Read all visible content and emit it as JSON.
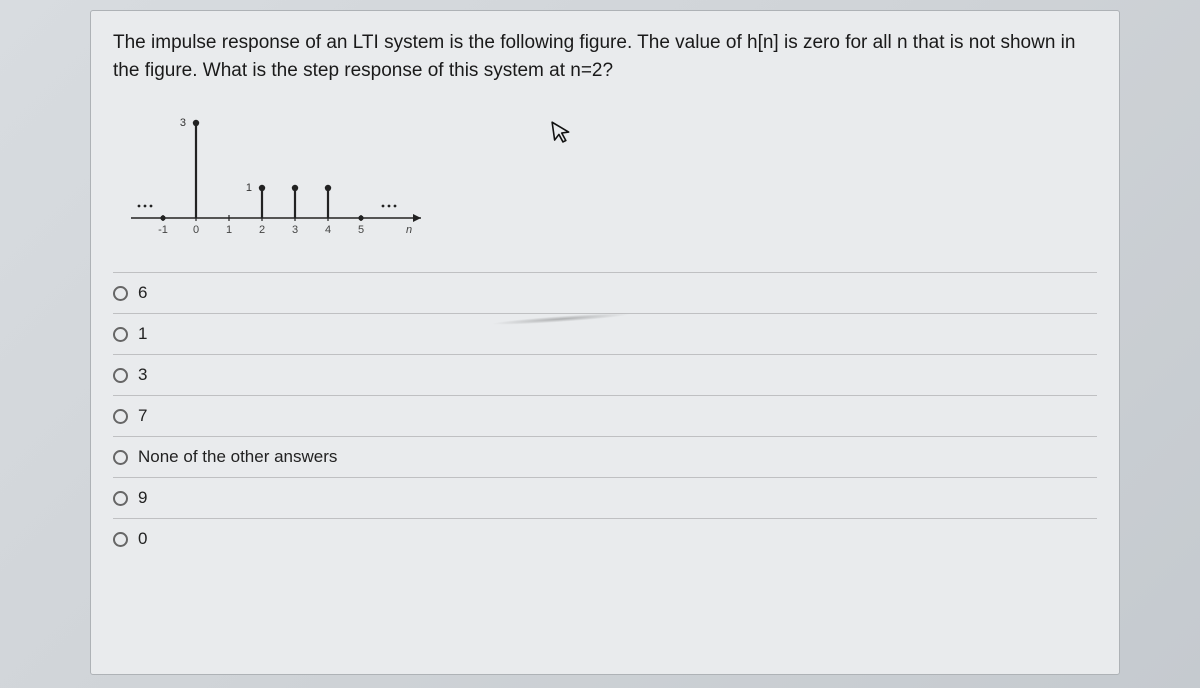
{
  "question": {
    "text": "The impulse response of an LTI system is the following figure. The value of h[n] is zero for all n that is not shown in the figure. What is the step response of this system at n=2?"
  },
  "chart_data": {
    "type": "bar",
    "title": "",
    "xlabel": "n",
    "ylabel": "",
    "ylim": [
      0,
      3
    ],
    "categories": [
      "-1",
      "0",
      "1",
      "2",
      "3",
      "4",
      "5",
      "n"
    ],
    "values": [
      0,
      3,
      0,
      1,
      1,
      1,
      0,
      0
    ],
    "y_label_markers": [
      "3",
      "1"
    ]
  },
  "options": [
    {
      "label": "6"
    },
    {
      "label": "1"
    },
    {
      "label": "3"
    },
    {
      "label": "7"
    },
    {
      "label": "None of the other answers"
    },
    {
      "label": "9"
    },
    {
      "label": "0"
    }
  ],
  "icons": {
    "cursor": "↖"
  }
}
